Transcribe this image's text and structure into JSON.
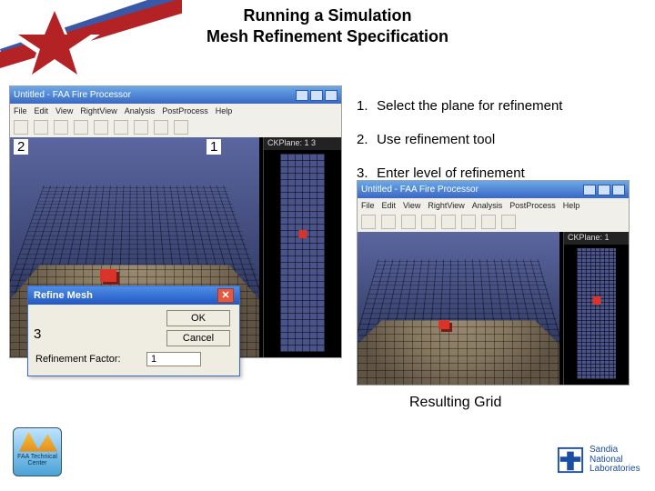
{
  "title_line1": "Running a Simulation",
  "title_line2": "Mesh Refinement Specification",
  "instructions": [
    {
      "num": "1.",
      "text": "Select the plane for refinement"
    },
    {
      "num": "2.",
      "text": "Use refinement tool"
    },
    {
      "num": "3.",
      "text": "Enter level of refinement"
    }
  ],
  "resulting_caption": "Resulting Grid",
  "main_window": {
    "title": "Untitled - FAA Fire Processor",
    "menus": [
      "File",
      "Edit",
      "View",
      "RightView",
      "Analysis",
      "PostProcess",
      "Help"
    ],
    "plane_label": "CKPlane: 1 3",
    "callout_2": "2",
    "callout_1": "1"
  },
  "result_window": {
    "title": "Untitled - FAA Fire Processor",
    "menus": [
      "File",
      "Edit",
      "View",
      "RightView",
      "Analysis",
      "PostProcess",
      "Help"
    ],
    "plane_label": "CKPlane: 1"
  },
  "dialog": {
    "title": "Refine Mesh",
    "ok": "OK",
    "cancel": "Cancel",
    "field_label": "Refinement Factor:",
    "field_value": "1",
    "callout_3": "3",
    "close_glyph": "✕"
  },
  "logos": {
    "faa_text": "FAA Technical Center",
    "sandia_text": "Sandia\nNational\nLaboratories"
  }
}
